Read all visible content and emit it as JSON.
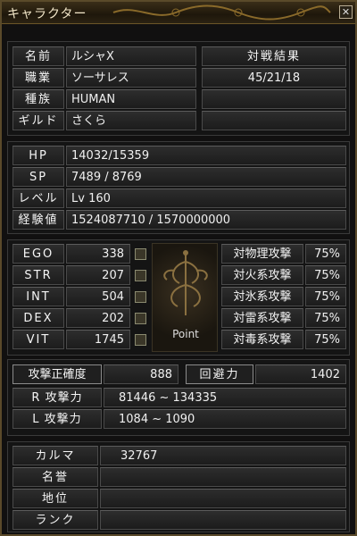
{
  "window": {
    "title": "キャラクター",
    "close_label": "✕"
  },
  "info": {
    "name_label": "名前",
    "name_value": "ルシャX",
    "job_label": "職業",
    "job_value": "ソーサレス",
    "race_label": "種族",
    "race_value": "HUMAN",
    "guild_label": "ギルド",
    "guild_value": "さくら",
    "battle_header": "対戦結果",
    "battle_value": "45/21/18"
  },
  "vitals": {
    "hp_label": "HP",
    "hp_value": "14032/15359",
    "sp_label": "SP",
    "sp_value": "7489 / 8769",
    "level_label": "レベル",
    "level_value": "Lv 160",
    "exp_label": "経験値",
    "exp_value": "1524087710 / 1570000000"
  },
  "stats": [
    {
      "label": "EGO",
      "value": "338"
    },
    {
      "label": "STR",
      "value": "207"
    },
    {
      "label": "INT",
      "value": "504"
    },
    {
      "label": "DEX",
      "value": "202"
    },
    {
      "label": "VIT",
      "value": "1745"
    }
  ],
  "point_label": "Point",
  "resist": [
    {
      "label": "対物理攻撃",
      "value": "75%"
    },
    {
      "label": "対火系攻撃",
      "value": "75%"
    },
    {
      "label": "対氷系攻撃",
      "value": "75%"
    },
    {
      "label": "対雷系攻撃",
      "value": "75%"
    },
    {
      "label": "対毒系攻撃",
      "value": "75%"
    }
  ],
  "combat": {
    "accuracy_label": "攻撃正確度",
    "accuracy_value": "888",
    "evasion_label": "回避力",
    "evasion_value": "1402",
    "r_attack_label": "R 攻撃力",
    "r_attack_value": "81446 ~ 134335",
    "l_attack_label": "L 攻撃力",
    "l_attack_value": "1084 ~ 1090"
  },
  "karma": {
    "karma_label": "カルマ",
    "karma_value": "32767",
    "fame_label": "名誉",
    "fame_value": "",
    "status_label": "地位",
    "status_value": "",
    "rank_label": "ランク",
    "rank_value": ""
  }
}
